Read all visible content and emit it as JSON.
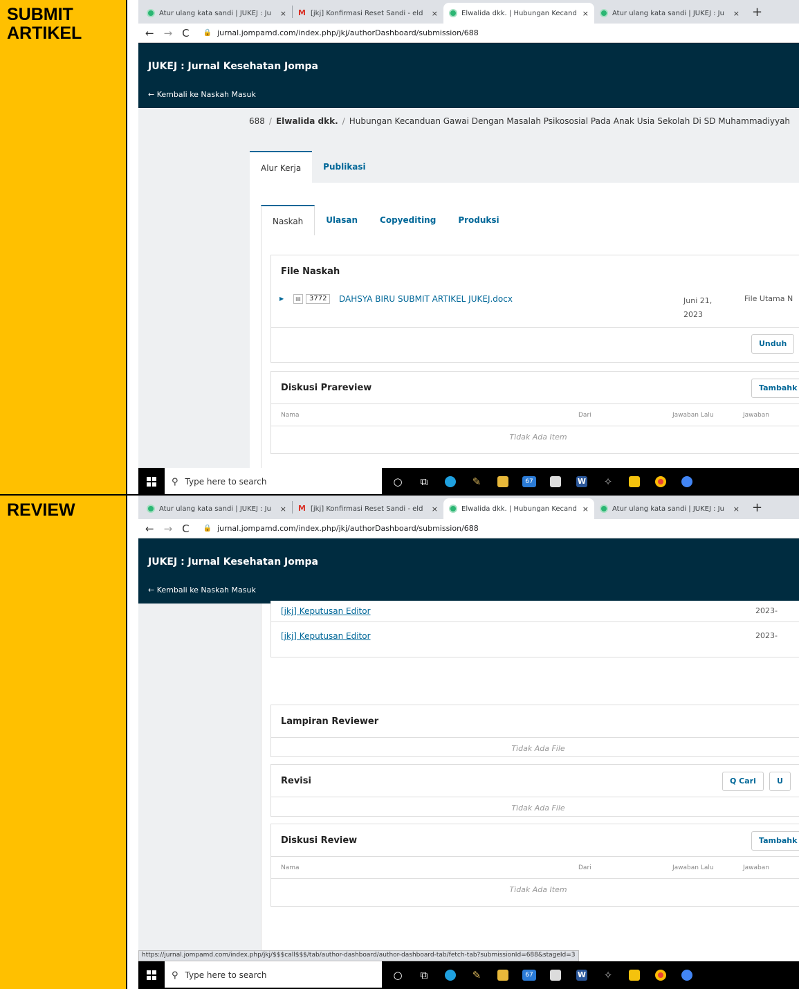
{
  "labels": {
    "row1": "SUBMIT\nARTIKEL",
    "row2": "REVIEW"
  },
  "browser": {
    "tabs": [
      {
        "title": "Atur ulang kata sandi | JUKEJ : Ju",
        "icon": "ojs-icon"
      },
      {
        "title": "[jkj] Konfirmasi Reset Sandi - eld",
        "icon": "gmail-icon"
      },
      {
        "title": "Elwalida dkk. | Hubungan Kecand",
        "icon": "ojs-icon"
      },
      {
        "title": "Atur ulang kata sandi | JUKEJ : Ju",
        "icon": "ojs-icon"
      }
    ],
    "close_glyph": "×",
    "new_tab": "+",
    "url": "jurnal.jompamd.com/index.php/jkj/authorDashboard/submission/688"
  },
  "app": {
    "title": "JUKEJ : Jurnal Kesehatan Jompa",
    "back_link": "← Kembali ke Naskah Masuk"
  },
  "shot1": {
    "breadcrumb": {
      "id": "688",
      "author": "Elwalida dkk.",
      "title": "Hubungan Kecanduan Gawai Dengan Masalah Psikososial Pada Anak Usia Sekolah Di SD Muhammadiyyah"
    },
    "outer_tabs": [
      "Alur Kerja",
      "Publikasi"
    ],
    "inner_tabs": [
      "Naskah",
      "Ulasan",
      "Copyediting",
      "Produksi"
    ],
    "file_section": {
      "title": "File Naskah",
      "file_id": "3772",
      "file_name": "DAHSYA BIRU SUBMIT ARTIKEL JUKEJ.docx",
      "date_line1": "Juni 21,",
      "date_line2": "2023",
      "type": "File Utama N",
      "download_button": "Unduh"
    },
    "discussion": {
      "title": "Diskusi Prareview",
      "add_button": "Tambahk",
      "columns": [
        "Nama",
        "Dari",
        "Jawaban Lalu",
        "Jawaban"
      ],
      "empty": "Tidak Ada Item"
    }
  },
  "shot2": {
    "notifications": [
      {
        "label": "[jkj] Keputusan Editor",
        "date": "2023-"
      },
      {
        "label": "[jkj] Keputusan Editor",
        "date": "2023-"
      }
    ],
    "reviewer_attachments": {
      "title": "Lampiran Reviewer",
      "empty": "Tidak Ada File"
    },
    "revisions": {
      "title": "Revisi",
      "search_button": "Q Cari",
      "upload_button": "U",
      "empty": "Tidak Ada File"
    },
    "review_discussion": {
      "title": "Diskusi Review",
      "add_button": "Tambahk",
      "columns": [
        "Nama",
        "Dari",
        "Jawaban Lalu",
        "Jawaban"
      ],
      "empty": "Tidak Ada Item"
    },
    "status_url": "https://jurnal.jompamd.com/index.php/jkj/$$$call$$$/tab/author-dashboard/author-dashboard-tab/fetch-tab?submissionId=688&stageId=3"
  },
  "taskbar": {
    "search_placeholder": "Type here to search",
    "mail_badge": "67"
  }
}
